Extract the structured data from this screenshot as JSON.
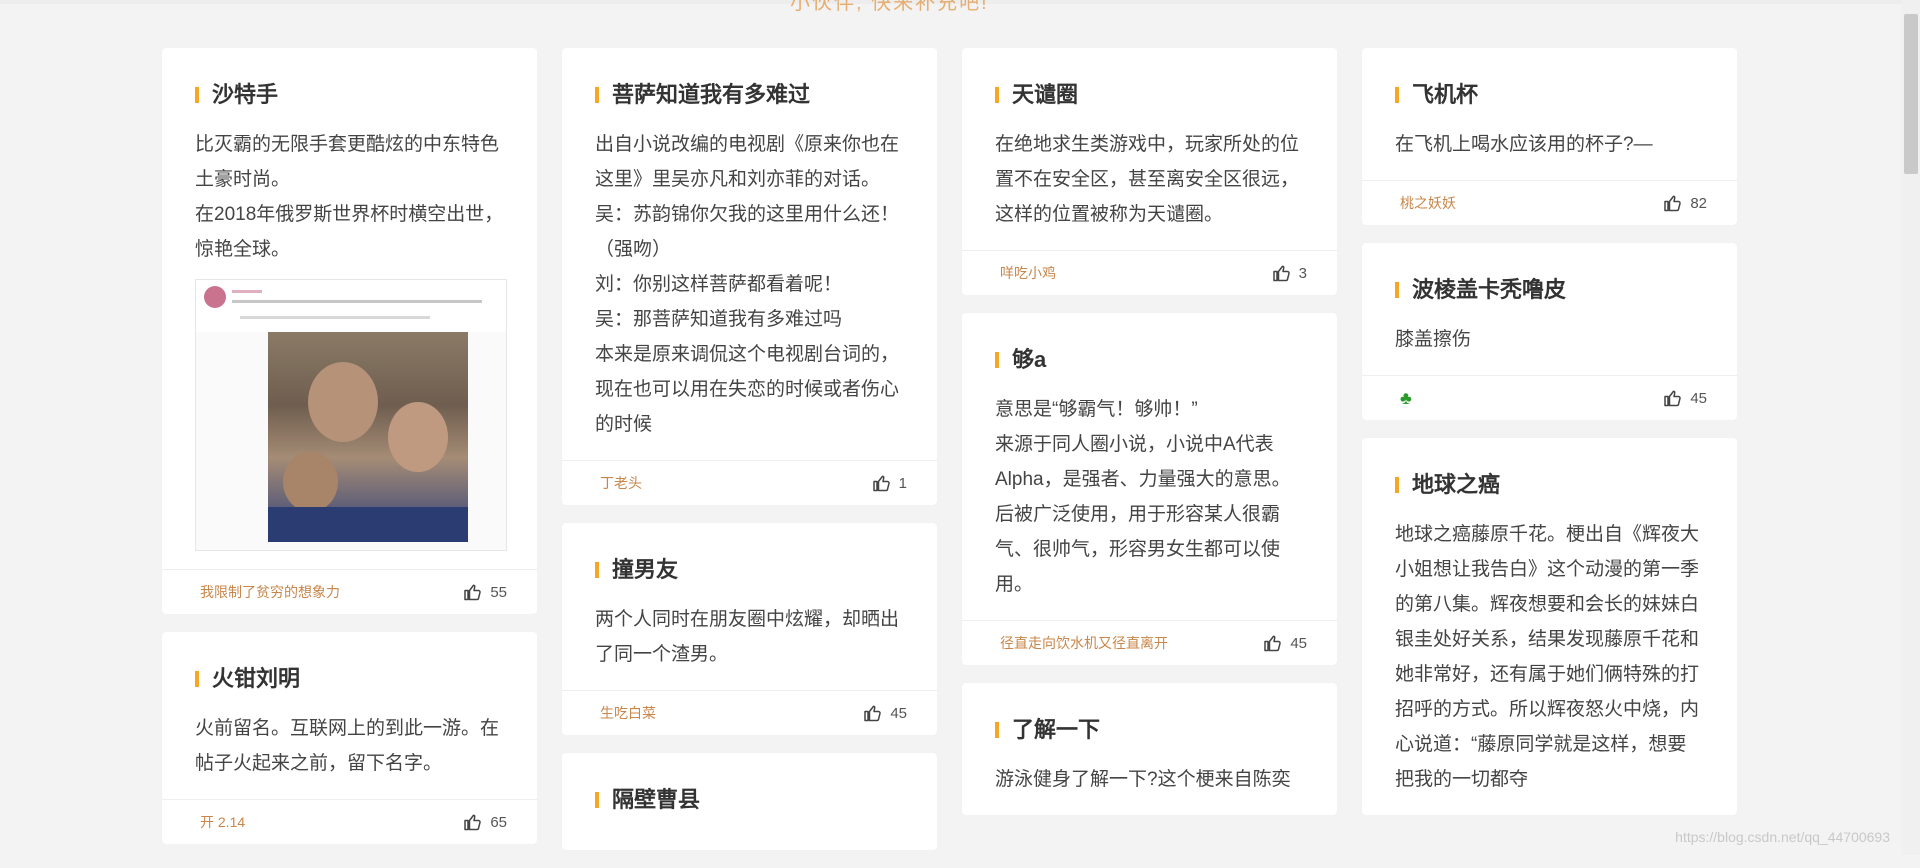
{
  "page": {
    "top_heading_partial": "小伙伴, 快来补充吧!",
    "watermark": "https://blog.csdn.net/qq_44700693"
  },
  "columns": [
    [
      {
        "title": "沙特手",
        "text": [
          "比灭霸的无限手套更酷炫的中东特色土豪时尚。",
          "在2018年俄罗斯世界杯时横空出世，惊艳全球。"
        ],
        "has_image": true,
        "author": "我限制了贫穷的想象力",
        "likes": "55"
      },
      {
        "title": "火钳刘明",
        "text": [
          "火前留名。互联网上的到此一游。在帖子火起来之前，留下名字。"
        ],
        "author": "开 2.14",
        "likes": "65"
      }
    ],
    [
      {
        "title": "菩萨知道我有多难过",
        "text": [
          "出自小说改编的电视剧《原来你也在这里》里吴亦凡和刘亦菲的对话。吴：苏韵锦你欠我的这里用什么还！（强吻）",
          "刘：你别这样菩萨都看着呢！",
          "吴：那菩萨知道我有多难过吗",
          "本来是原来调侃这个电视剧台词的，现在也可以用在失恋的时候或者伤心的时候"
        ],
        "author": "丁老头",
        "likes": "1"
      },
      {
        "title": "撞男友",
        "text": [
          "两个人同时在朋友圈中炫耀，却晒出了同一个渣男。"
        ],
        "author": "生吃白菜",
        "likes": "45"
      },
      {
        "title": "隔壁曹县",
        "text": [],
        "author": "",
        "likes": ""
      }
    ],
    [
      {
        "title": "天谴圈",
        "text": [
          "在绝地求生类游戏中，玩家所处的位置不在安全区，甚至离安全区很远，这样的位置被称为天谴圈。"
        ],
        "author": "咩吃小鸡",
        "likes": "3"
      },
      {
        "title": "够a",
        "text": [
          "意思是“够霸气！够帅！”",
          "来源于同人圈小说，小说中A代表Alpha，是强者、力量强大的意思。后被广泛使用，用于形容某人很霸气、很帅气，形容男女生都可以使用。"
        ],
        "author": "径直走向饮水机又径直离开",
        "likes": "45"
      },
      {
        "title": "了解一下",
        "text": [
          "游泳健身了解一下?这个梗来自陈奕"
        ],
        "author": "",
        "likes": ""
      }
    ],
    [
      {
        "title": "飞机杯",
        "text": [
          "在飞机上喝水应该用的杯子?—"
        ],
        "author": "桃之妖妖",
        "likes": "82"
      },
      {
        "title": "波棱盖卡秃噜皮",
        "text": [
          "膝盖擦伤"
        ],
        "author_icon": "clover-icon",
        "author": "",
        "likes": "45"
      },
      {
        "title": "地球之癌",
        "text": [
          "地球之癌藤原千花。梗出自《辉夜大小姐想让我告白》这个动漫的第一季的第八集。辉夜想要和会长的妹妹白银圭处好关系，结果发现藤原千花和她非常好，还有属于她们俩特殊的打招呼的方式。所以辉夜怒火中烧，内心说道：“藤原同学就是这样，想要把我的一切都夺"
        ],
        "author": "",
        "likes": ""
      }
    ]
  ]
}
